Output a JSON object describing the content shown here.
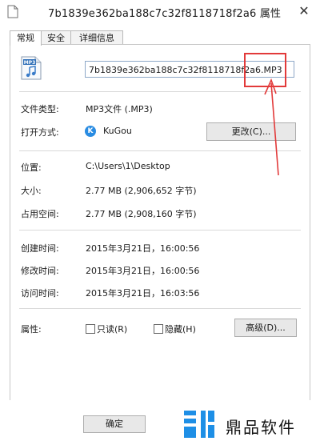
{
  "window": {
    "title": "7b1839e362ba188c7c32f8118718f2a6 属性",
    "close_glyph": "✕"
  },
  "tabs": [
    {
      "label": "常规",
      "active": true
    },
    {
      "label": "安全",
      "active": false
    },
    {
      "label": "详细信息",
      "active": false
    }
  ],
  "file": {
    "icon_label": "MP3",
    "name": "7b1839e362ba188c7c32f8118718f2a6.MP3"
  },
  "props": {
    "type_label": "文件类型:",
    "type_value": "MP3文件 (.MP3)",
    "opens_label": "打开方式:",
    "opens_value": "KuGou",
    "opens_icon_letter": "K",
    "change_button": "更改(C)...",
    "location_label": "位置:",
    "location_value": "C:\\Users\\1\\Desktop",
    "size_label": "大小:",
    "size_value": "2.77 MB (2,906,652 字节)",
    "disk_label": "占用空间:",
    "disk_value": "2.77 MB (2,908,160 字节)",
    "created_label": "创建时间:",
    "created_value": "2015年3月21日，16:00:56",
    "modified_label": "修改时间:",
    "modified_value": "2015年3月21日，16:00:56",
    "accessed_label": "访问时间:",
    "accessed_value": "2015年3月21日，16:03:56",
    "attrs_label": "属性:",
    "readonly_label": "只读(R)",
    "hidden_label": "隐藏(H)",
    "advanced_button": "高级(D)..."
  },
  "footer": {
    "ok_label": "确定"
  },
  "watermark": {
    "text": "鼎品软件"
  },
  "colors": {
    "annotation": "#e23a3a",
    "kugou": "#2a8ce2",
    "watermark_blue": "#1e8fe6"
  }
}
